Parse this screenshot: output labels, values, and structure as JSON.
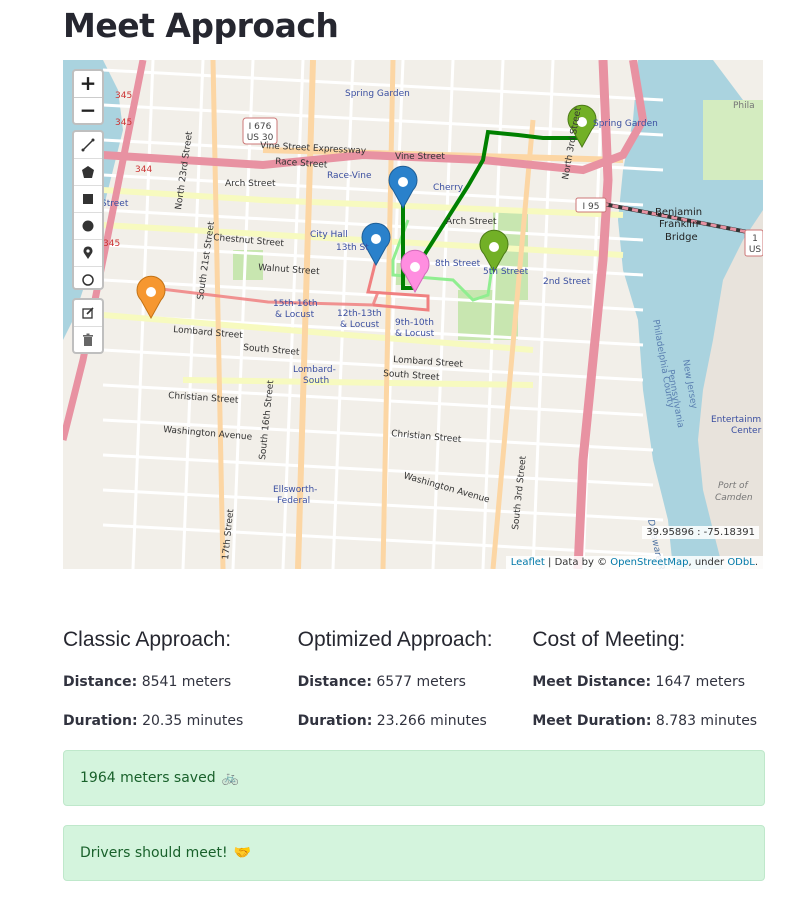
{
  "page": {
    "title": "Meet Approach"
  },
  "map": {
    "controls": {
      "zoom_in": "+",
      "zoom_out": "−",
      "draw_tools": [
        "polyline-icon",
        "polygon-icon",
        "rectangle-icon",
        "circle-icon",
        "marker-icon",
        "circlemarker-icon"
      ],
      "edit_tools": [
        "edit-icon",
        "trash-icon"
      ]
    },
    "labels": {
      "spring_garden": "Spring Garden",
      "spring_garden_e": "Spring Garden",
      "vine_expressway": "Vine Street Expressway",
      "vine_street": "Vine Street",
      "race_street": "Race Street",
      "race_vine": "Race-Vine",
      "arch_street": "Arch Street",
      "arch_street2": "Arch Street",
      "cherry": "Cherry",
      "chestnut": "Chestnut Street",
      "walnut": "Walnut Street",
      "city_hall": "City Hall",
      "thirteenth": "13th St",
      "eighth": "8th Street",
      "fifth": "5th Street",
      "second": "2nd Street",
      "b1516": "15th-16th",
      "locust1": "& Locust",
      "b1213": "12th-13th",
      "locust2": "& Locust",
      "b910": "9th-10th",
      "locust3": "& Locust",
      "lombard": "Lombard Street",
      "lombard2": "Lombard Street",
      "south": "South Street",
      "south2": "South Street",
      "lombard_south": "Lombard-",
      "lombard_south2": "South",
      "christian": "Christian Street",
      "christian2": "Christian Street",
      "washington": "Washington Avenue",
      "washington2": "Washington Avenue",
      "ellsworth": "Ellsworth-",
      "ellsworth2": "Federal",
      "north23": "North 23rd Street",
      "north21": "South 21st Street",
      "south16": "South 16th Street",
      "south3": "South 3rd Street",
      "north3": "North 3rd Street",
      "seventeenth": "17th Street",
      "benjamin": "Benjamin",
      "franklin": "Franklin",
      "bridge": "Bridge",
      "i95": "I 95",
      "i676": "I 676",
      "us30": "US 30",
      "delaware": "Delaware River",
      "philadelphia_county": "Philadelphia County",
      "pennsylvania": "Pennsylvania",
      "new_jersey": "New Jersey",
      "port": "Port of",
      "camden": "Camden",
      "entertainment": "Entertainm",
      "center": "Center",
      "phila": "Phila",
      "r345": "345",
      "r344": "344",
      "street_left": "Street",
      "us_short": "US",
      "r1": "1"
    },
    "coordinates": "39.95896 : -75.18391",
    "attribution": {
      "leaflet": "Leaflet",
      "data_by": "| Data by ©",
      "osm": "OpenStreetMap",
      "under": ", under",
      "odbl": "ODbL",
      "period": "."
    },
    "colors": {
      "route_dark_green": "#008000",
      "route_light_green": "#90ee90",
      "route_red": "#f08080",
      "marker_blue": "#2a81cb",
      "marker_green": "#72b026",
      "marker_orange": "#f69730",
      "marker_pink": "#ff8ee0"
    }
  },
  "classic": {
    "title": "Classic Approach:",
    "distance_label": "Distance:",
    "distance_value": " 8541 meters",
    "duration_label": "Duration:",
    "duration_value": " 20.35 minutes"
  },
  "optimized": {
    "title": "Optimized Approach:",
    "distance_label": "Distance:",
    "distance_value": " 6577 meters",
    "duration_label": "Duration:",
    "duration_value": " 23.266 minutes"
  },
  "cost": {
    "title": "Cost of Meeting:",
    "distance_label": "Meet Distance:",
    "distance_value": " 1647 meters",
    "duration_label": "Meet Duration:",
    "duration_value": " 8.783 minutes"
  },
  "alerts": {
    "saved": "1964 meters saved",
    "saved_emoji": "🚲",
    "meet": "Drivers should meet!",
    "meet_emoji": "🤝"
  }
}
